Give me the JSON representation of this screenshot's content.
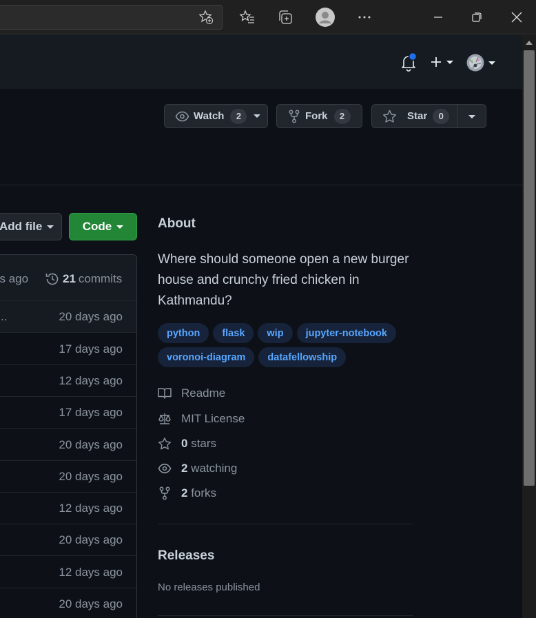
{
  "browser": {
    "icons": [
      "add-favorite-icon",
      "favorites-icon",
      "collections-icon",
      "profile-icon",
      "more-icon"
    ],
    "window_controls": [
      "minimize-icon",
      "restore-icon",
      "close-icon"
    ]
  },
  "header": {
    "icons": [
      "bell-icon",
      "plus-icon",
      "avatar"
    ],
    "notification_color": "#1f6feb"
  },
  "repo_actions": {
    "watch": {
      "label": "Watch",
      "count": "2"
    },
    "fork": {
      "label": "Fork",
      "count": "2"
    },
    "star": {
      "label": "Star",
      "count": "0"
    }
  },
  "file_actions": {
    "add_file": "Add file",
    "code": "Code"
  },
  "file_list": {
    "last_commit_ago": "ys ago",
    "commits_count": "21",
    "commits_label": "commits",
    "rows": [
      {
        "ellipsis": "..",
        "ago": "20 days ago"
      },
      {
        "ellipsis": "",
        "ago": "17 days ago"
      },
      {
        "ellipsis": "",
        "ago": "12 days ago"
      },
      {
        "ellipsis": "",
        "ago": "17 days ago"
      },
      {
        "ellipsis": "",
        "ago": "20 days ago"
      },
      {
        "ellipsis": "",
        "ago": "20 days ago"
      },
      {
        "ellipsis": "",
        "ago": "12 days ago"
      },
      {
        "ellipsis": "",
        "ago": "20 days ago"
      },
      {
        "ellipsis": "",
        "ago": "12 days ago"
      },
      {
        "ellipsis": "",
        "ago": "20 days ago"
      }
    ]
  },
  "about": {
    "title": "About",
    "description": "Where should someone open a new burger house and crunchy fried chicken in Kathmandu?",
    "topics": [
      "python",
      "flask",
      "wip",
      "jupyter-notebook",
      "voronoi-diagram",
      "datafellowship"
    ],
    "readme": "Readme",
    "license": "MIT License",
    "stars_count": "0",
    "stars_label": "stars",
    "watching_count": "2",
    "watching_label": "watching",
    "forks_count": "2",
    "forks_label": "forks"
  },
  "releases": {
    "title": "Releases",
    "empty": "No releases published"
  },
  "colors": {
    "background": "#0d1117",
    "accent_link": "#58a6ff",
    "code_button": "#238636"
  }
}
